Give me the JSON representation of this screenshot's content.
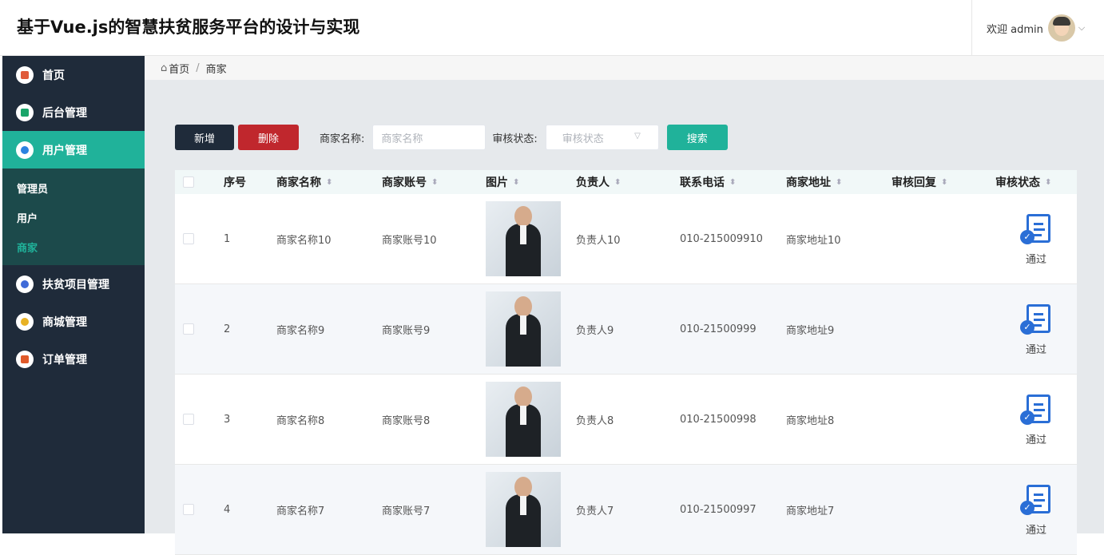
{
  "header": {
    "title": "基于Vue.js的智慧扶贫服务平台的设计与实现",
    "welcome": "欢迎 admin",
    "caret": "⌵"
  },
  "sidebar": {
    "items": [
      {
        "label": "首页",
        "icon": "home-icon",
        "color": "#e05a3a"
      },
      {
        "label": "后台管理",
        "icon": "copy-icon",
        "color": "#1aa56a"
      },
      {
        "label": "用户管理",
        "icon": "user-icon",
        "color": "#2b83e0"
      },
      {
        "label": "扶贫项目管理",
        "icon": "compass-icon",
        "color": "#3f6ad8"
      },
      {
        "label": "商城管理",
        "icon": "coin-icon",
        "color": "#e8b225"
      },
      {
        "label": "订单管理",
        "icon": "order-icon",
        "color": "#e05a2a"
      }
    ],
    "submenu": [
      {
        "label": "管理员"
      },
      {
        "label": "用户"
      },
      {
        "label": "商家"
      }
    ]
  },
  "breadcrumb": {
    "home": "首页",
    "sep": "/",
    "current": "商家"
  },
  "toolbar": {
    "add_label": "新增",
    "delete_label": "删除",
    "name_label": "商家名称:",
    "name_placeholder": "商家名称",
    "status_label": "审核状态:",
    "status_placeholder": "审核状态",
    "search_label": "搜索"
  },
  "table": {
    "columns": [
      "序号",
      "商家名称",
      "商家账号",
      "图片",
      "负责人",
      "联系电话",
      "商家地址",
      "审核回复",
      "审核状态"
    ],
    "rows": [
      {
        "index": "1",
        "name": "商家名称10",
        "account": "商家账号10",
        "person": "负责人10",
        "phone": "010-215009910",
        "address": "商家地址10",
        "reply": "",
        "status": "通过"
      },
      {
        "index": "2",
        "name": "商家名称9",
        "account": "商家账号9",
        "person": "负责人9",
        "phone": "010-21500999",
        "address": "商家地址9",
        "reply": "",
        "status": "通过"
      },
      {
        "index": "3",
        "name": "商家名称8",
        "account": "商家账号8",
        "person": "负责人8",
        "phone": "010-21500998",
        "address": "商家地址8",
        "reply": "",
        "status": "通过"
      },
      {
        "index": "4",
        "name": "商家名称7",
        "account": "商家账号7",
        "person": "负责人7",
        "phone": "010-21500997",
        "address": "商家地址7",
        "reply": "",
        "status": "通过"
      }
    ]
  },
  "colors": {
    "sidebar": "#1f2b3a",
    "accent": "#20b29a",
    "danger": "#c0272d",
    "status_icon": "#2a6ed6"
  }
}
